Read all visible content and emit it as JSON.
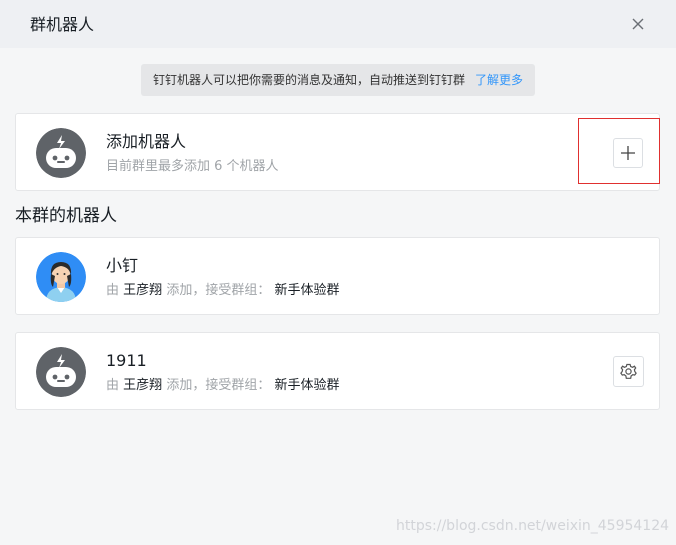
{
  "window": {
    "title": "群机器人",
    "close_icon": "close-icon"
  },
  "notice": {
    "text": "钉钉机器人可以把你需要的消息及通知，自动推送到钉钉群",
    "link": "了解更多"
  },
  "add_robot": {
    "title": "添加机器人",
    "subtitle": "目前群里最多添加 6 个机器人",
    "button_icon": "plus-icon"
  },
  "section": {
    "title": "本群的机器人"
  },
  "robots": [
    {
      "name": "小钉",
      "by": "由",
      "creator": "王彦翔",
      "added_text": "添加，接受群组：",
      "group": "新手体验群",
      "avatar": "person-avatar"
    },
    {
      "name": "1911",
      "by": "由",
      "creator": "王彦翔",
      "added_text": "添加，接受群组：",
      "group": "新手体验群",
      "avatar": "robot-avatar",
      "settings_icon": "gear-icon"
    }
  ],
  "watermark": "https://blog.csdn.net/weixin_45954124",
  "colors": {
    "link": "#3296fa",
    "avatar_gray": "#5f6368",
    "highlight_frame": "#e0302f"
  }
}
